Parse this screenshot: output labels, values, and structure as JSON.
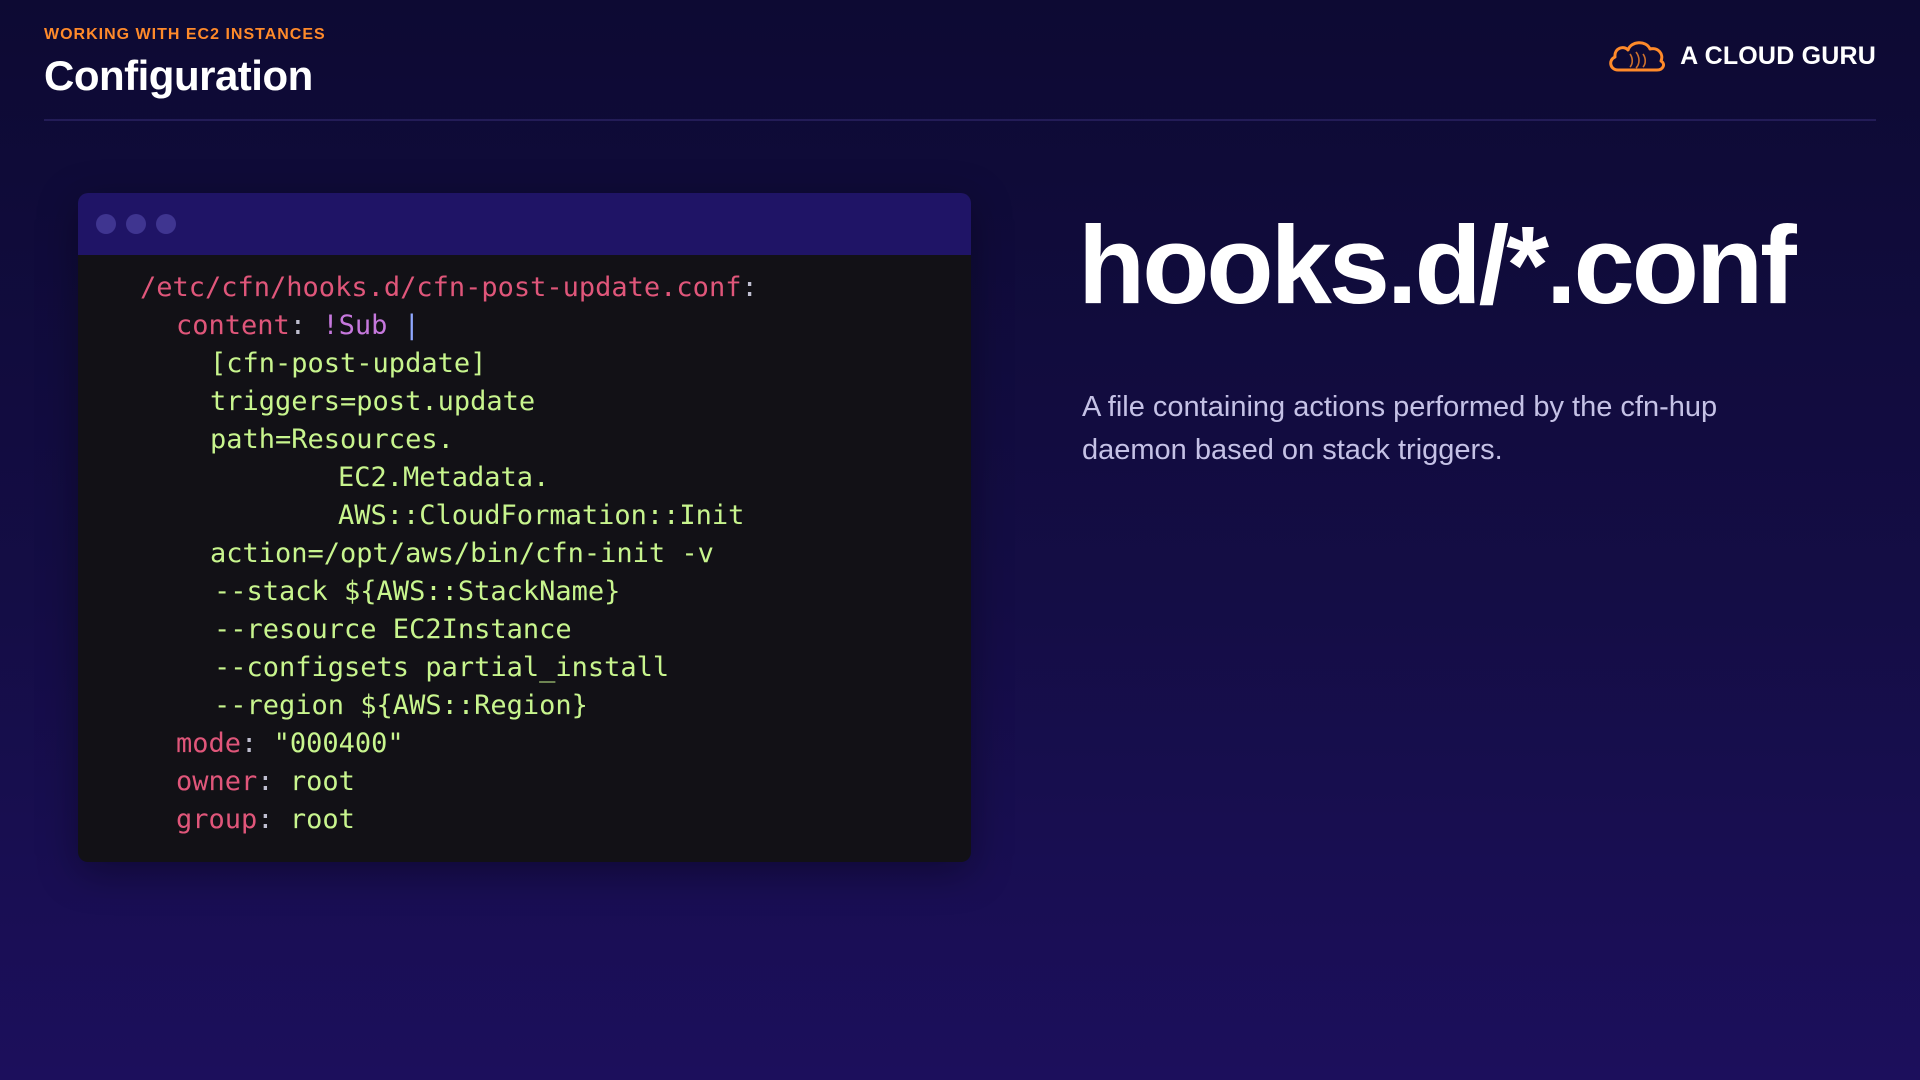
{
  "header": {
    "eyebrow": "WORKING WITH EC2 INSTANCES",
    "title": "Configuration"
  },
  "brand": {
    "name": "A CLOUD GURU",
    "icon": "cloud-logo-icon",
    "accent_color": "#ff8a2a"
  },
  "code": {
    "window_dots": [
      "window-dot",
      "window-dot",
      "window-dot"
    ],
    "lines": {
      "l1_path": "/etc/cfn/hooks.d/cfn-post-update.conf",
      "l1_colon": ":",
      "l2_key": "content",
      "l2_colon": ":",
      "l2_tag": "!Sub",
      "l2_bar": "|",
      "l3": "[cfn-post-update]",
      "l4": "triggers=post.update",
      "l5": "path=Resources.",
      "l6": "EC2.Metadata.",
      "l7": "AWS::CloudFormation::Init",
      "l8": "action=/opt/aws/bin/cfn-init -v",
      "l9": "--stack ${AWS::StackName}",
      "l10": "--resource EC2Instance",
      "l11": "--configsets partial_install",
      "l12": "--region ${AWS::Region}",
      "l13_key": "mode",
      "l13_colon": ":",
      "l13_val": "\"000400\"",
      "l14_key": "owner",
      "l14_colon": ":",
      "l14_val": "root",
      "l15_key": "group",
      "l15_colon": ":",
      "l15_val": "root"
    }
  },
  "main": {
    "heading": "hooks.d/*.conf",
    "description": "A file containing actions performed by the cfn-hup daemon based on stack triggers."
  }
}
